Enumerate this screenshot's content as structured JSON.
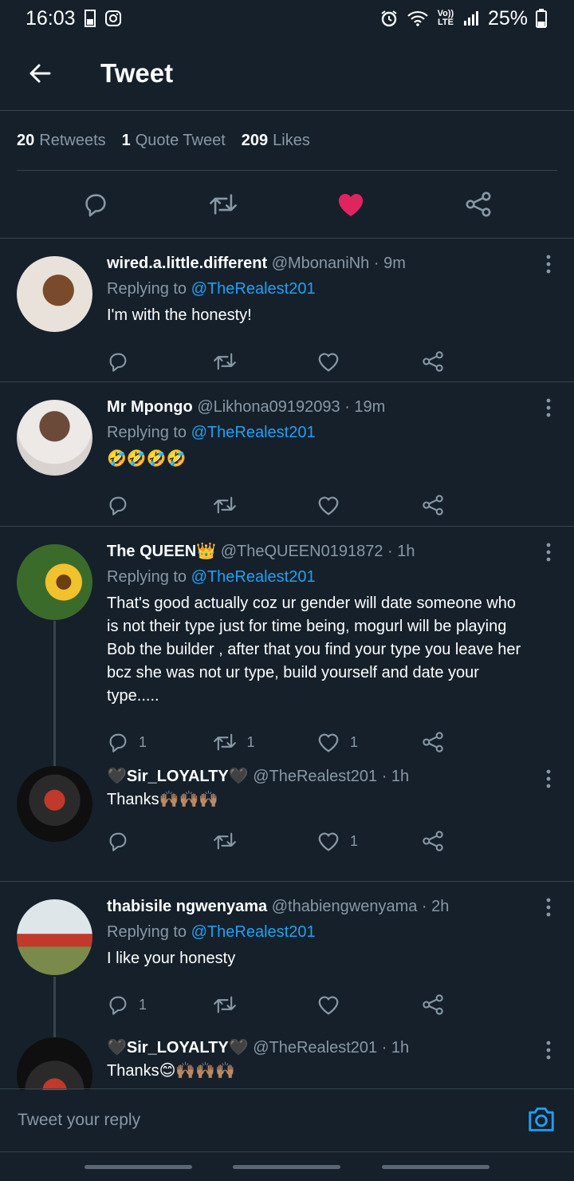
{
  "status_bar": {
    "time": "16:03",
    "battery": "25%",
    "volte": "Vo)) LTE"
  },
  "appbar": {
    "title": "Tweet"
  },
  "stats": [
    {
      "count": "20",
      "label": "Retweets"
    },
    {
      "count": "1",
      "label": "Quote Tweet"
    },
    {
      "count": "209",
      "label": "Likes"
    }
  ],
  "replies": [
    {
      "name": "wired.a.little.different",
      "handle": "@MbonaniNh · 9m",
      "replying_prefix": "Replying to",
      "replying_to": "@TheRealest201",
      "text": "I'm with the honesty!",
      "counts": {
        "reply": "",
        "retweet": "",
        "like": ""
      }
    },
    {
      "name": "Mr Mpongo",
      "handle": "@Likhona09192093 · 19m",
      "replying_prefix": "Replying to",
      "replying_to": "@TheRealest201",
      "text": "🤣🤣🤣🤣",
      "counts": {
        "reply": "",
        "retweet": "",
        "like": ""
      }
    },
    {
      "name": "The QUEEN👑",
      "handle": "@TheQUEEN0191872 · 1h",
      "replying_prefix": "Replying to",
      "replying_to": "@TheRealest201",
      "text": "That's good actually coz ur gender will date someone who is not their type just for time being, mogurl will be playing Bob the builder , after that you find your type you leave her bcz she was not ur type, build yourself and date your type.....",
      "counts": {
        "reply": "1",
        "retweet": "1",
        "like": "1"
      }
    },
    {
      "name": "🖤Sir_LOYALTY🖤",
      "handle": "@TheRealest201 · 1h",
      "text": "Thanks🙌🏽🙌🏽🙌🏽",
      "counts": {
        "reply": "",
        "retweet": "",
        "like": "1"
      }
    },
    {
      "name": "thabisile ngwenyama",
      "handle": "@thabiengwenyama · 2h",
      "replying_prefix": "Replying to",
      "replying_to": "@TheRealest201",
      "text": "I like your honesty",
      "counts": {
        "reply": "1",
        "retweet": "",
        "like": ""
      }
    },
    {
      "name": "🖤Sir_LOYALTY🖤",
      "handle": "@TheRealest201 · 1h",
      "text": "Thanks😊🙌🏽🙌🏽🙌🏽"
    }
  ],
  "composer": {
    "placeholder": "Tweet your reply"
  },
  "colors": {
    "background": "#15202b",
    "accent": "#1da1f2",
    "like": "#e0245e",
    "muted": "#8899a6",
    "divider": "#38444d"
  },
  "icons": [
    "back-arrow-icon",
    "reply-icon",
    "retweet-icon",
    "heart-icon",
    "share-icon",
    "more-icon",
    "camera-icon"
  ]
}
